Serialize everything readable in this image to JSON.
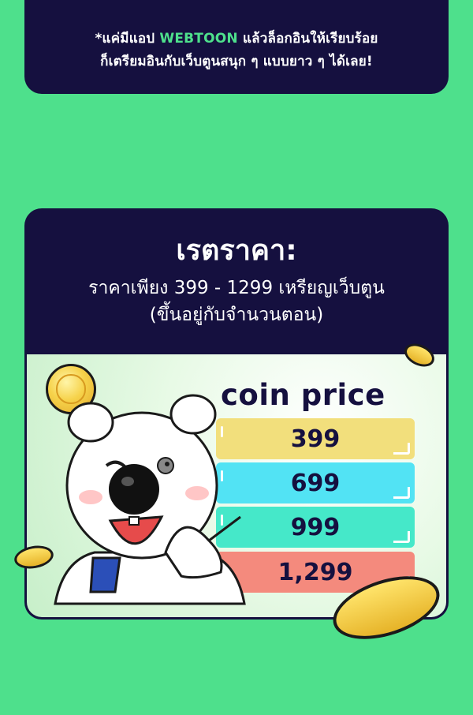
{
  "banner": {
    "line1_prefix": "*แค่มีแอป ",
    "brand": "WEBTOON",
    "line1_suffix": " แล้วล็อกอินให้เรียบร้อย",
    "line2": "ก็เตรียมอินกับเว็บตูนสนุก ๆ แบบยาว ๆ ได้เลย!"
  },
  "card": {
    "title": "เรตราคา:",
    "subtitle_line1": "ราคาเพียง 399 - 1299 เหรียญเว็บตูน",
    "subtitle_line2": "(ขึ้นอยู่กับจำนวนตอน)"
  },
  "prices": {
    "title": "coin price",
    "items": [
      {
        "label": "399",
        "color": "#f2df7c"
      },
      {
        "label": "699",
        "color": "#52e3f4"
      },
      {
        "label": "999",
        "color": "#45e8c9"
      },
      {
        "label": "1,299",
        "color": "#f48a7d"
      }
    ]
  },
  "colors": {
    "background": "#4ee08c",
    "navy": "#15103f",
    "accent_green": "#4ee08c"
  },
  "icons": [
    "coin-icon",
    "polar-bear-mascot"
  ]
}
